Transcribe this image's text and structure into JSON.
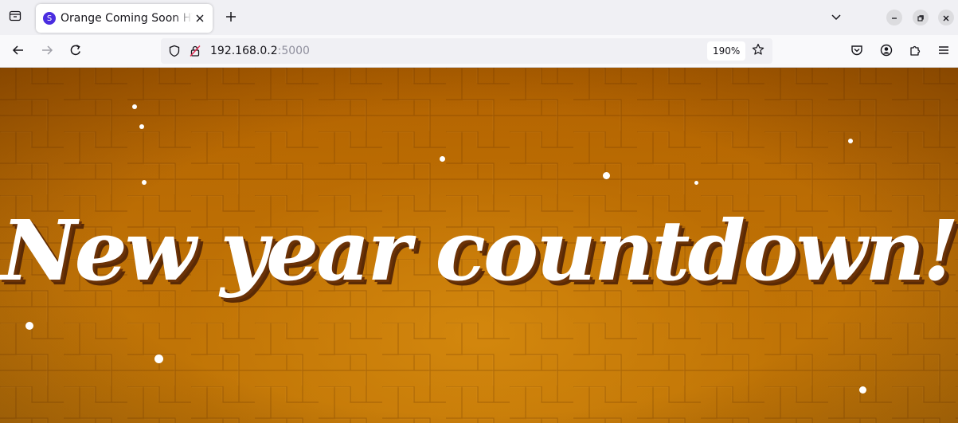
{
  "browser": {
    "tab": {
      "title": "Orange Coming Soon HTML Template",
      "favicon_letter": "S"
    },
    "url": {
      "host": "192.168.0.2",
      "port": ":5000"
    },
    "zoom": "190%"
  },
  "page": {
    "headline": "New year countdown!"
  },
  "colors": {
    "background_orange": "#c07408",
    "headline_text": "#ffffff",
    "headline_shadow": "#5a2a05",
    "favicon": "#4a2de0"
  },
  "icons": {
    "tab_list": "tab-list-icon",
    "close": "close-icon",
    "new_tab": "plus-icon",
    "overflow": "chevron-down-icon",
    "back": "arrow-left-icon",
    "forward": "arrow-right-icon",
    "reload": "reload-icon",
    "tracking": "shield-icon",
    "insecure": "lock-slash-icon",
    "bookmark": "star-icon",
    "pocket": "pocket-icon",
    "account": "account-icon",
    "extensions": "puzzle-icon",
    "menu": "hamburger-icon"
  }
}
